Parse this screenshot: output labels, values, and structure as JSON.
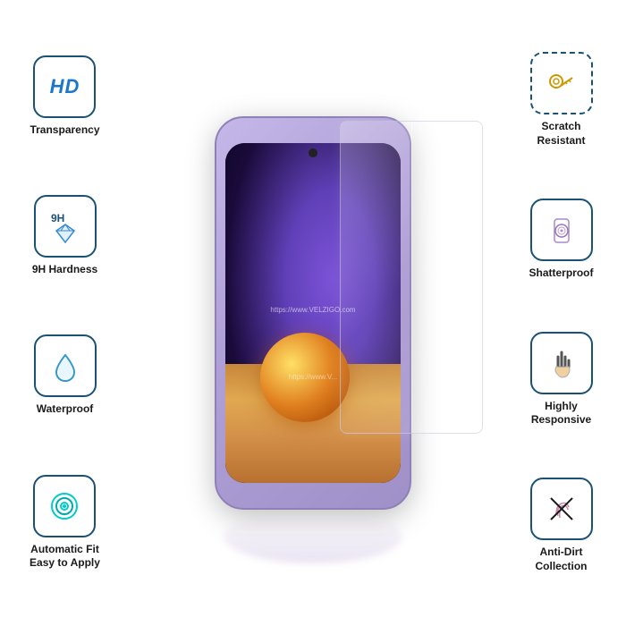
{
  "features": {
    "left": [
      {
        "id": "hd-transparency",
        "icon_type": "hd_text",
        "label": "Transparency"
      },
      {
        "id": "9h-hardness",
        "icon_type": "diamond",
        "label": "9H Hardness"
      },
      {
        "id": "waterproof",
        "icon_type": "water_drop",
        "label": "Waterproof"
      },
      {
        "id": "auto-fit",
        "icon_type": "target_circle",
        "label": "Automatic Fit\nEasy to Apply"
      }
    ],
    "right": [
      {
        "id": "scratch-resistant",
        "icon_type": "key",
        "label": "Scratch\nResistant"
      },
      {
        "id": "shatterproof",
        "icon_type": "phone_shield",
        "label": "Shatterproof"
      },
      {
        "id": "highly-responsive",
        "icon_type": "hand_touch",
        "label": "Highly\nResponsive"
      },
      {
        "id": "anti-dirt",
        "icon_type": "fingerprint_cross",
        "label": "Anti-Dirt\nCollection"
      }
    ]
  },
  "watermark": "https://www.VELZIGO.com",
  "watermark2": "https://www.V..."
}
